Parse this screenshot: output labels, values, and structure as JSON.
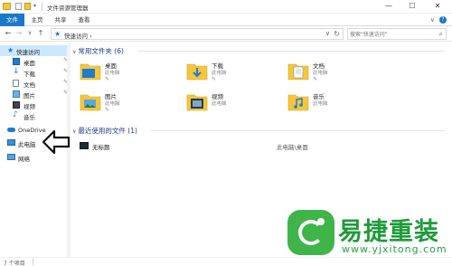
{
  "window": {
    "title": "文件资源管理器",
    "minimize": "—",
    "maximize": "☐",
    "close": "✕"
  },
  "ribbon": {
    "tabs": [
      "文件",
      "主页",
      "共享",
      "查看"
    ],
    "expand": "∨",
    "help": "?"
  },
  "address": {
    "back": "←",
    "forward": "→",
    "recent": "∨",
    "up": "↑",
    "path": "快速访问",
    "path_sep": "›",
    "dropdown": "∨",
    "refresh": "↻",
    "search_placeholder": "搜索\"快速访问\"",
    "search_icon": "⌕"
  },
  "navpane": {
    "quick_access": "快速访问",
    "items": [
      {
        "label": "桌面",
        "icon": "desktop-icon",
        "pinned": true
      },
      {
        "label": "下载",
        "icon": "download-icon",
        "pinned": true
      },
      {
        "label": "文档",
        "icon": "documents-icon",
        "pinned": true
      },
      {
        "label": "图片",
        "icon": "pictures-icon",
        "pinned": true
      },
      {
        "label": "视频",
        "icon": "videos-icon",
        "pinned": false
      },
      {
        "label": "音乐",
        "icon": "music-icon",
        "pinned": false
      }
    ],
    "onedrive": "OneDrive",
    "this_pc": "此电脑",
    "network": "网络",
    "pin_glyph": "✎"
  },
  "frequent": {
    "header": "常用文件夹 (6)",
    "chevron": "∨",
    "folders": [
      {
        "name": "桌面",
        "sub": "此电脑"
      },
      {
        "name": "下载",
        "sub": "此电脑"
      },
      {
        "name": "文档",
        "sub": "此电脑"
      },
      {
        "name": "图片",
        "sub": "此电脑"
      },
      {
        "name": "视频",
        "sub": "此电脑"
      },
      {
        "name": "音乐",
        "sub": "此电脑"
      }
    ]
  },
  "recent": {
    "header": "最近使用的文件 (1)",
    "chevron": "∨",
    "files": [
      {
        "name": "无标题",
        "location": "此电脑\\桌面"
      }
    ]
  },
  "status": {
    "item_count": "7 个项目"
  },
  "watermark": {
    "title": "易捷重装",
    "url": "www.yjxitong.com"
  },
  "colors": {
    "accent": "#1979ca",
    "selection": "#cce8ff",
    "folder": "#f5c63b",
    "watermark_green": "#1e9b3a"
  }
}
